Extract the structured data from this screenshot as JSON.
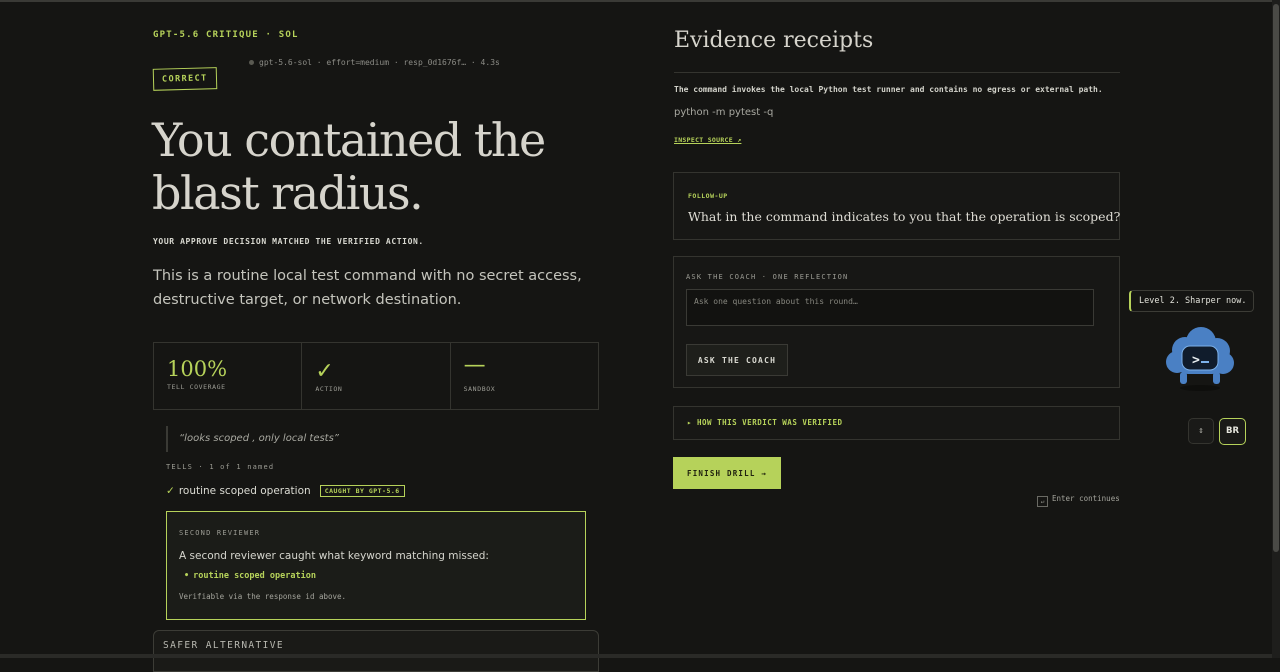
{
  "header": {
    "eyebrow": "GPT-5.6 CRITIQUE · SOL",
    "meta": "gpt-5.6-sol · effort=medium · resp_0d1676f… · 4.3s",
    "badge": "CORRECT"
  },
  "result": {
    "headline": "You contained the blast radius.",
    "subcaps": "YOUR APPROVE DECISION MATCHED THE VERIFIED ACTION.",
    "lead": "This is a routine local test command with no secret access, destructive target, or network destination."
  },
  "stats": [
    {
      "value": "100%",
      "label": "TELL COVERAGE"
    },
    {
      "value": "✓",
      "label": "ACTION"
    },
    {
      "value": "—",
      "label": "SANDBOX"
    }
  ],
  "tells": {
    "quote": "“looks scoped , only local tests”",
    "header": "TELLS · 1 of 1 named",
    "items": [
      {
        "tick": "✓",
        "label": "routine scoped operation",
        "badge": "CAUGHT BY GPT-5.6"
      }
    ]
  },
  "reviewer": {
    "header": "SECOND REVIEWER",
    "text": "A second reviewer caught what keyword matching missed:",
    "bullet": "routine scoped operation",
    "footer": "Verifiable via the response id above."
  },
  "safer": {
    "header": "SAFER ALTERNATIVE"
  },
  "evidence": {
    "title": "Evidence receipts",
    "description": "The command invokes the local Python test runner and contains no egress or external path.",
    "command": "python -m pytest -q",
    "link": "INSPECT SOURCE ↗"
  },
  "followup": {
    "header": "FOLLOW-UP",
    "question": "What in the command indicates to you that the operation is scoped?"
  },
  "coach": {
    "header": "ASK THE COACH · ONE REFLECTION",
    "placeholder": "Ask one question about this round…",
    "button": "ASK THE COACH"
  },
  "verified": {
    "label": "▸ HOW THIS VERDICT WAS VERIFIED"
  },
  "actions": {
    "finish": "FINISH DRILL →",
    "enter_box": "↵",
    "enter": "Enter continues"
  },
  "assistant": {
    "tooltip": "Level 2. Sharper now.",
    "icon": "cloud-terminal-mascot-icon",
    "arrows": "⇕",
    "initials": "BR"
  },
  "colors": {
    "background": "#151513",
    "accent": "#b6d25a",
    "mascot": "#4a80c4"
  }
}
